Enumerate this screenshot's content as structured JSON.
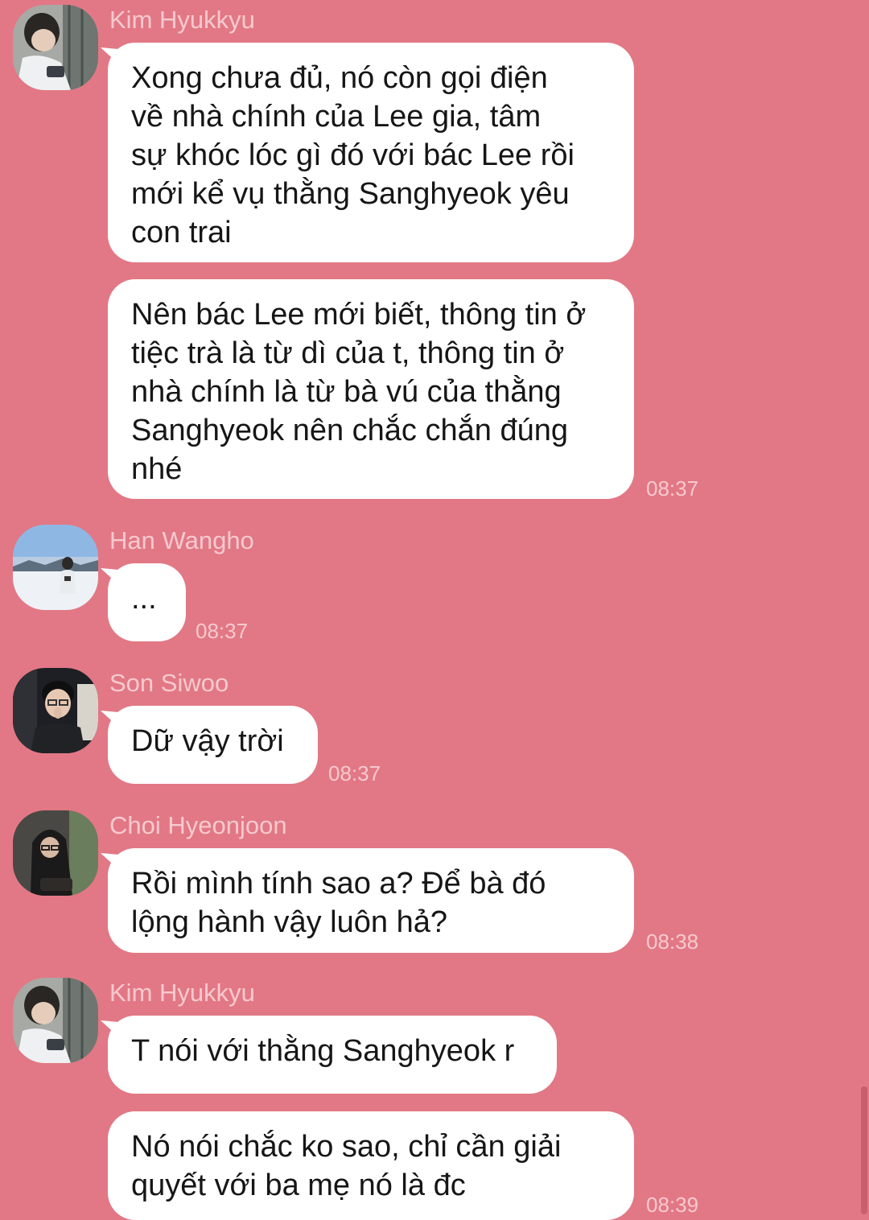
{
  "messages": [
    {
      "sender": "Kim Hyukkyu",
      "avatar": "kim-hyukkyu-avatar",
      "bubbles": [
        "Xong chưa đủ, nó còn gọi điện\nvề nhà chính của Lee gia, tâm\nsự khóc lóc gì đó với bác Lee rồi\nmới kể vụ thằng Sanghyeok yêu\ncon trai",
        "Nên bác Lee mới biết, thông tin ở\ntiệc trà là từ dì của t, thông tin ở\nnhà chính là từ bà vú của thằng\nSanghyeok nên chắc chắn đúng\nnhé"
      ],
      "time": "08:37"
    },
    {
      "sender": "Han Wangho",
      "avatar": "han-wangho-avatar",
      "bubbles": [
        "..."
      ],
      "time": "08:37"
    },
    {
      "sender": "Son Siwoo",
      "avatar": "son-siwoo-avatar",
      "bubbles": [
        "Dữ vậy trời"
      ],
      "time": "08:37"
    },
    {
      "sender": "Choi Hyeonjoon",
      "avatar": "choi-hyeonjoon-avatar",
      "bubbles": [
        "Rồi mình tính sao a? Để bà đó\nlộng hành vậy luôn hả?"
      ],
      "time": "08:38"
    },
    {
      "sender": "Kim Hyukkyu",
      "avatar": "kim-hyukkyu-avatar",
      "bubbles": [
        "T nói với thằng Sanghyeok r",
        "Nó nói chắc ko sao, chỉ cần giải\nquyết với ba mẹ nó là đc"
      ],
      "time": "08:39"
    }
  ],
  "colors": {
    "background": "#e27885",
    "bubble": "#ffffff",
    "meta_text": "#f6c9cf",
    "message_text": "#161616"
  }
}
